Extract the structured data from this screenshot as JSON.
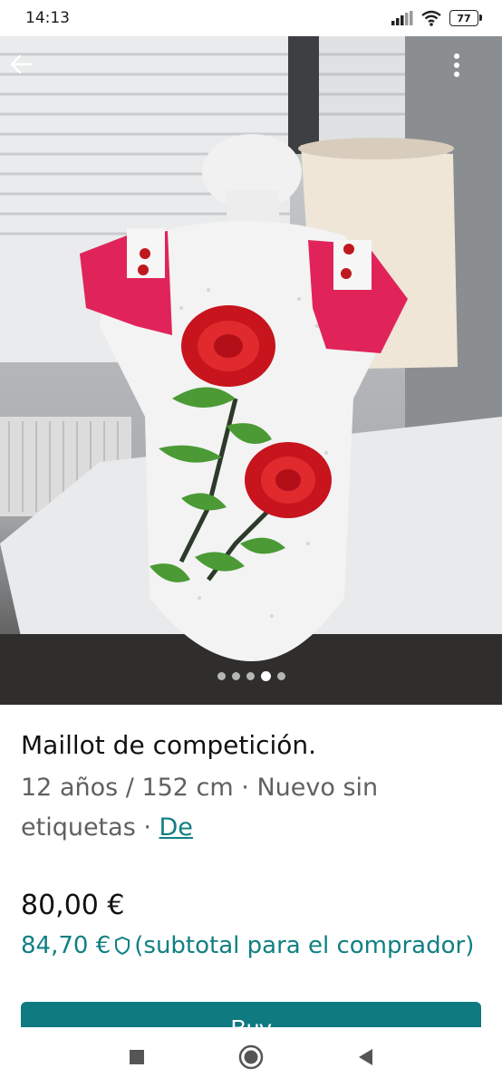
{
  "status_bar": {
    "time": "14:13",
    "battery": "77",
    "icons": [
      "signal-icon",
      "wifi-icon",
      "battery-icon"
    ]
  },
  "photo": {
    "back_icon": "arrow-left-icon",
    "more_icon": "more-vertical-icon",
    "carousel_count": 5,
    "carousel_active": 3
  },
  "item": {
    "title": "Maillot de competición.",
    "subtitle_text": "12 años / 152 cm · Nuevo sin etiquetas · ",
    "subtitle_link": "De",
    "price": "80,00 €",
    "buyer_price": "84,70 €",
    "buyer_price_note": "(subtotal para el comprador)",
    "buyer_icon": "shield-icon"
  },
  "buy_button": {
    "label": "Buy"
  },
  "nav_bar": {
    "icons": [
      "square-icon",
      "circle-icon",
      "triangle-back-icon"
    ]
  },
  "colors": {
    "accent": "#117f82",
    "button": "#0f7a80"
  }
}
